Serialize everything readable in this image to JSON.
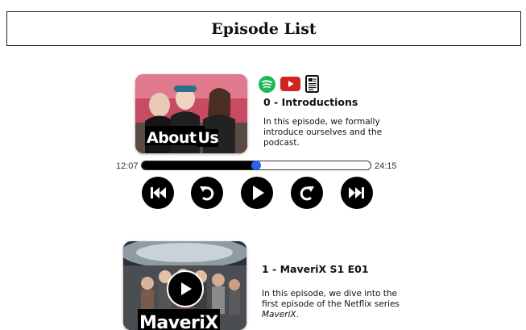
{
  "header": {
    "title": "Episode List"
  },
  "episodes": [
    {
      "thumb_title": "About Us",
      "thumb_title_a": "About",
      "thumb_title_b": "Us",
      "title": "0 - Introductions",
      "description": "In this episode, we formally introduce ourselves and the podcast.",
      "platform_icons": [
        "spotify-icon",
        "youtube-icon",
        "transcript-icon"
      ],
      "player": {
        "current_time": "12:07",
        "total_time": "24:15",
        "progress": 0.5
      },
      "controls": [
        "skip-back-icon",
        "rewind-icon",
        "play-icon",
        "forward-icon",
        "skip-forward-icon"
      ]
    },
    {
      "thumb_title": "MaveriX",
      "title": "1 - MaveriX S1 E01",
      "description_prefix": "In this episode, we dive into the first episode of the Netflix series",
      "description_italic": "MaveriX",
      "description_suffix": "."
    }
  ],
  "colors": {
    "accent": "#2563e8",
    "spotify": "#1db954",
    "youtube": "#d32222"
  }
}
